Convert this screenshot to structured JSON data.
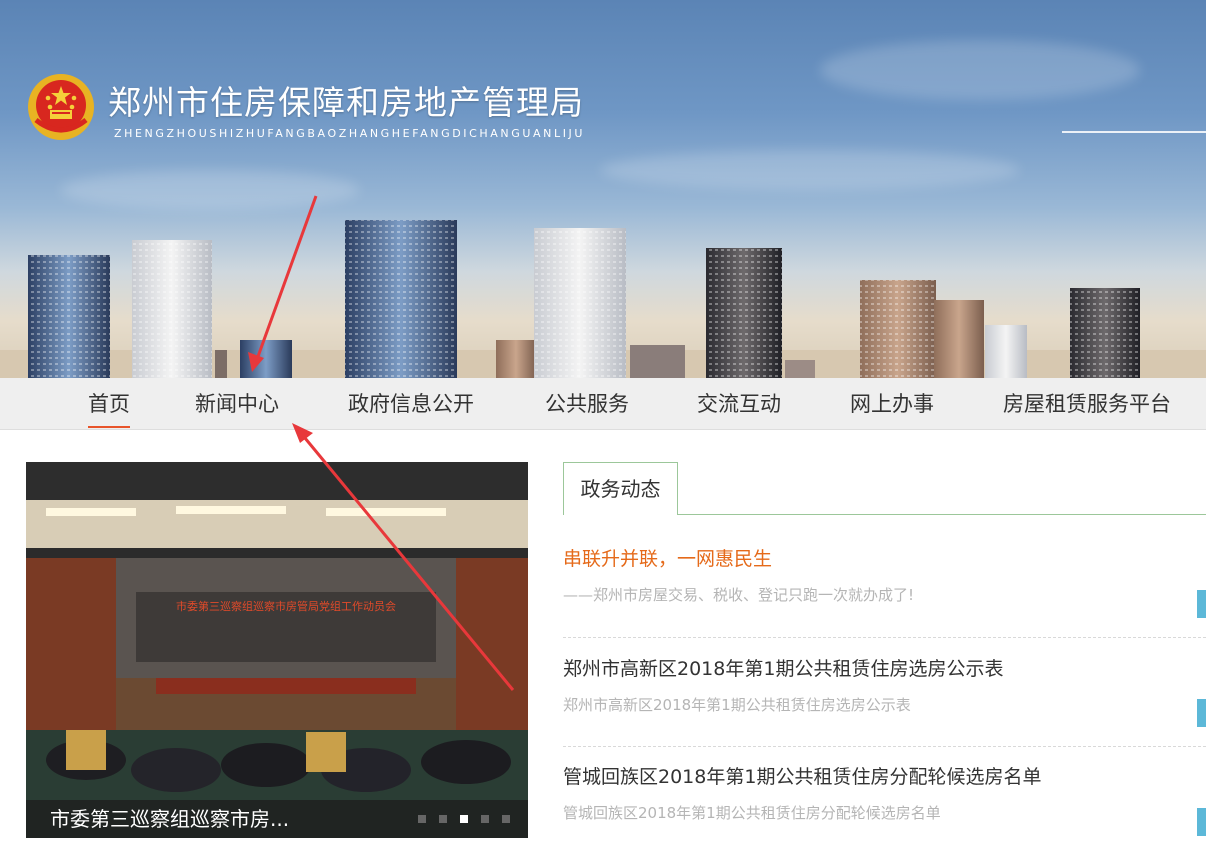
{
  "header": {
    "title": "郑州市住房保障和房地产管理局",
    "subtitle": "ZHENGZHOUSHIZHUFANGBAOZHANGHEFANGDICHANGUANLIJU",
    "emblem_icon": "national-emblem-icon"
  },
  "nav": {
    "items": [
      {
        "label": "首页",
        "active": true
      },
      {
        "label": "新闻中心",
        "active": false
      },
      {
        "label": "政府信息公开",
        "active": false
      },
      {
        "label": "公共服务",
        "active": false
      },
      {
        "label": "交流互动",
        "active": false
      },
      {
        "label": "网上办事",
        "active": false
      },
      {
        "label": "房屋租赁服务平台",
        "active": false
      }
    ],
    "accent_color": "#e8542a"
  },
  "slider": {
    "caption": "市委第三巡察组巡察市房...",
    "photo_banner_text": "市委第三巡察组巡察市房管局党组工作动员会",
    "slide_count": 5,
    "active_slide": 3
  },
  "news": {
    "tab_label": "政务动态",
    "items": [
      {
        "title": "串联升并联，一网惠民生",
        "subtitle": "——郑州市房屋交易、税收、登记只跑一次就办成了!",
        "highlight": true
      },
      {
        "title": "郑州市高新区2018年第1期公共租赁住房选房公示表",
        "subtitle": "郑州市高新区2018年第1期公共租赁住房选房公示表",
        "highlight": false
      },
      {
        "title": "管城回族区2018年第1期公共租赁住房分配轮候选房名单",
        "subtitle": "管城回族区2018年第1期公共租赁住房分配轮候选房名单",
        "highlight": false
      }
    ],
    "highlight_color": "#e56a1a",
    "marker_color": "#5cb8d8"
  },
  "annotations": {
    "arrow_color": "#e8383b",
    "arrow_icon": "red-arrow-icon"
  }
}
